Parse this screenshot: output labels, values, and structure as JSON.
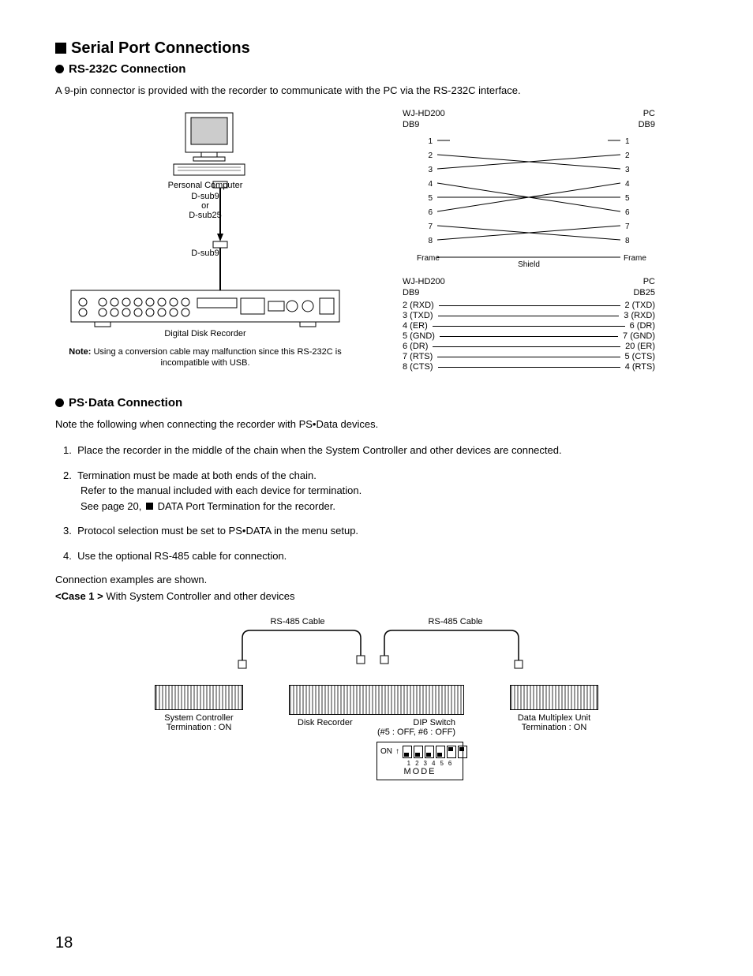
{
  "heading": "Serial Port Connections",
  "section1": {
    "title": "RS-232C Connection",
    "intro": "A 9-pin connector is provided with the recorder to communicate with the PC via the RS-232C interface.",
    "leftFigure": {
      "pcLabel": "Personal Computer",
      "dsub9": "D-sub9",
      "or": "or",
      "dsub25": "D-sub25",
      "recorderLabel": "Digital Disk Recorder",
      "noteBold": "Note:",
      "noteText": " Using a conversion cable may malfunction since this RS-232C is incompatible with USB."
    },
    "rightFigure": {
      "topLeftHead": "WJ-HD200",
      "topLeftSub": "DB9",
      "topRightHead": "PC",
      "topRightSub": "DB9",
      "pins1to8": [
        "1",
        "2",
        "3",
        "4",
        "5",
        "6",
        "7",
        "8"
      ],
      "frame": "Frame",
      "shield": "Shield",
      "botLeftHead": "WJ-HD200",
      "botLeftSub": "DB9",
      "botRightHead": "PC",
      "botRightSub": "DB25",
      "map": [
        {
          "l": "2 (RXD)",
          "r": "2 (TXD)"
        },
        {
          "l": "3 (TXD)",
          "r": "3 (RXD)"
        },
        {
          "l": "4 (ER)",
          "r": "6 (DR)"
        },
        {
          "l": "5 (GND)",
          "r": "7 (GND)"
        },
        {
          "l": "6 (DR)",
          "r": "20 (ER)"
        },
        {
          "l": "7 (RTS)",
          "r": "5 (CTS)"
        },
        {
          "l": "8 (CTS)",
          "r": "4 (RTS)"
        }
      ]
    }
  },
  "section2": {
    "title": "PS·Data Connection",
    "intro": "Note the following when connecting the recorder with PS•Data devices.",
    "items": [
      "Place the recorder in the middle of the chain when the System Controller and other devices are connected.",
      "Termination must be made at both ends of the chain.\nRefer to the manual included with each device for termination.\nSee page 20, ■ DATA Port Termination for the recorder.",
      "Protocol selection must be set to PS•DATA in the menu setup.",
      "Use the optional RS-485 cable for connection."
    ],
    "examplesLine": "Connection examples are shown.",
    "case1Bold": "<Case 1 >",
    "case1Rest": " With System Controller and other devices",
    "diagram": {
      "rs485": "RS-485 Cable",
      "sysController": "System Controller",
      "sysTerm": "Termination : ON",
      "diskRecorder": "Disk Recorder",
      "dipSwitch": "DIP Switch",
      "dipState": "(#5 : OFF, #6 : OFF)",
      "dmu": "Data Multiplex Unit",
      "dmuTerm": "Termination : ON",
      "on": "ON",
      "mode": "MODE",
      "slotNums": [
        "1",
        "2",
        "3",
        "4",
        "5",
        "6"
      ]
    }
  },
  "pageNumber": "18"
}
